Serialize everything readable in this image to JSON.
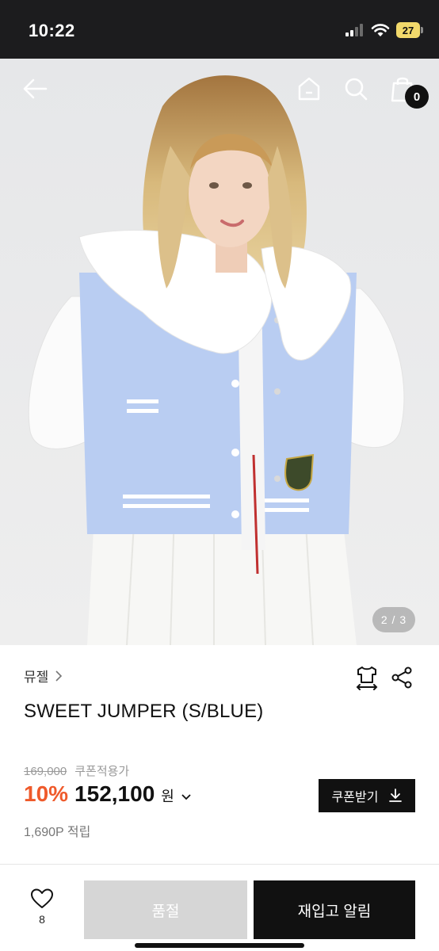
{
  "status_bar": {
    "time": "10:22",
    "battery": "27"
  },
  "nav": {
    "cart_count": "0"
  },
  "gallery": {
    "counter": "2 / 3"
  },
  "product": {
    "brand": "뮤젤",
    "title": "SWEET JUMPER (S/BLUE)",
    "original_price": "169,000",
    "coupon_note": "쿠폰적용가",
    "discount": "10%",
    "price": "152,100",
    "currency": "원",
    "points": "1,690P 적립"
  },
  "coupon_button": {
    "label": "쿠폰받기"
  },
  "bottom_bar": {
    "like_count": "8",
    "soldout_label": "품절",
    "restock_label": "재입고 알림"
  },
  "colors": {
    "accent": "#ef5a2b",
    "dark": "#111111",
    "disabled": "#d6d6d6"
  }
}
